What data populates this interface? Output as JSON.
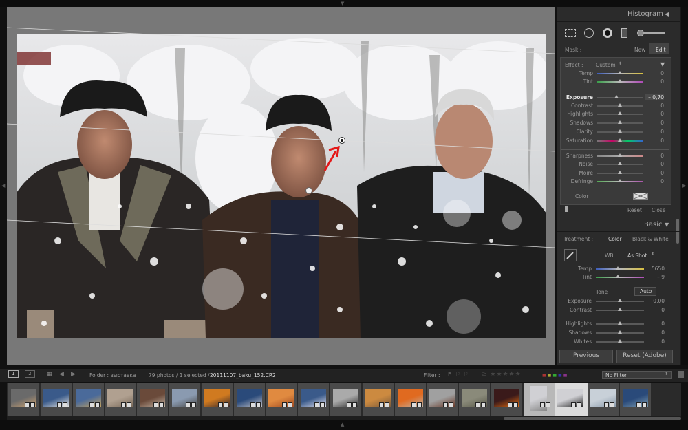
{
  "histogram": {
    "title": "Histogram",
    "collapse_icon": "triangle-left-icon"
  },
  "mask": {
    "label": "Mask :",
    "new": "New",
    "edit": "Edit"
  },
  "effect": {
    "label": "Effect :",
    "value": "Custom",
    "menu_icon": "triangle-down-icon"
  },
  "local_sliders": [
    {
      "name": "Temp",
      "value": "0",
      "level": 0.5
    },
    {
      "name": "Tint",
      "value": "0",
      "level": 0.5
    },
    {
      "name": "Exposure",
      "value": "– 0,70",
      "level": 0.42
    },
    {
      "name": "Contrast",
      "value": "0",
      "level": 0.5
    },
    {
      "name": "Highlights",
      "value": "0",
      "level": 0.5
    },
    {
      "name": "Shadows",
      "value": "0",
      "level": 0.5
    },
    {
      "name": "Clarity",
      "value": "0",
      "level": 0.5
    },
    {
      "name": "Saturation",
      "value": "0",
      "level": 0.5
    },
    {
      "name": "Sharpness",
      "value": "0",
      "level": 0.5
    },
    {
      "name": "Noise",
      "value": "0",
      "level": 0.5
    },
    {
      "name": "Moiré",
      "value": "0",
      "level": 0.5
    },
    {
      "name": "Defringe",
      "value": "0",
      "level": 0.5
    }
  ],
  "color_label": "Color",
  "mask_footer": {
    "reset": "Reset",
    "close": "Close"
  },
  "basic": {
    "title": "Basic",
    "treatment_label": "Treatment :",
    "color": "Color",
    "bw": "Black & White",
    "wb_label": "WB :",
    "wb_value": "As Shot",
    "temp": {
      "name": "Temp",
      "value": "5650",
      "level": 0.45
    },
    "tint": {
      "name": "Tint",
      "value": "– 9",
      "level": 0.46
    },
    "tone_label": "Tone",
    "auto": "Auto",
    "exposure": {
      "name": "Exposure",
      "value": "0,00",
      "level": 0.5
    },
    "contrast": {
      "name": "Contrast",
      "value": "0",
      "level": 0.5
    },
    "highlights": {
      "name": "Highlights",
      "value": "0",
      "level": 0.5
    },
    "shadows": {
      "name": "Shadows",
      "value": "0",
      "level": 0.5
    },
    "whites": {
      "name": "Whites",
      "value": "0",
      "level": 0.5
    }
  },
  "buttons": {
    "previous": "Previous",
    "reset": "Reset (Adobe)"
  },
  "filmbar": {
    "view1": "1",
    "view2": "2",
    "folder_label": "Folder : выставка",
    "count": "79 photos / 1 selected /",
    "filename": "20111107_baku_152.CR2",
    "filter_label": "Filter :",
    "filter_value": "No Filter"
  },
  "filmstrip_count": 20,
  "selected_index": 17
}
